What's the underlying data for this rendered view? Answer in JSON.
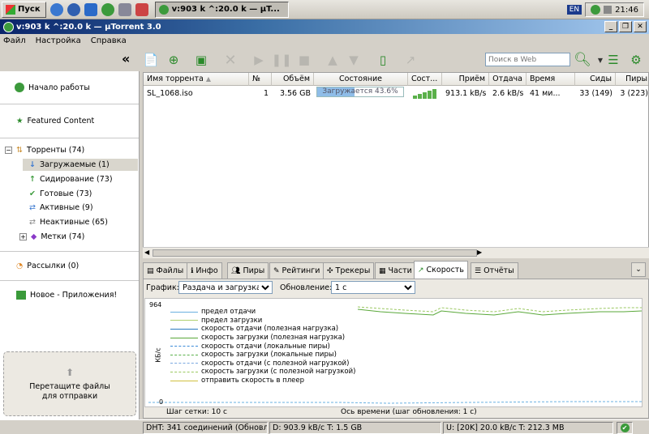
{
  "taskbar": {
    "start_label": "Пуск",
    "task_title": "v:903 k ^:20.0 k — µT...",
    "lang": "EN",
    "clock": "21:46"
  },
  "window": {
    "title": "v:903 k ^:20.0 k — µTorrent 3.0"
  },
  "menu": [
    "Файл",
    "Настройка",
    "Справка"
  ],
  "toolbar": {
    "collapse_label": "«",
    "search_placeholder": "Поиск в Web"
  },
  "sidebar": {
    "getting_started": "Начало работы",
    "featured": "Featured Content",
    "torrents": "Торренты (74)",
    "downloading": "Загружаемые (1)",
    "seeding": "Сидирование (73)",
    "completed": "Готовые (73)",
    "active": "Активные (9)",
    "inactive": "Неактивные (65)",
    "labels": "Метки (74)",
    "feeds": "Рассылки (0)",
    "apps": "Новое - Приложения!",
    "drop_line1": "Перетащите файлы",
    "drop_line2": "для отправки"
  },
  "table": {
    "headers": [
      "Имя торрента",
      "№",
      "Объём",
      "Состояние",
      "Сост...",
      "Приём",
      "Отдача",
      "Время",
      "Сиды",
      "Пиры"
    ],
    "row": {
      "name": "SL_1068.iso",
      "num": "1",
      "size": "3.56 GB",
      "status": "Загружается 43.6%",
      "progress": 0.436,
      "down": "913.1 kB/s",
      "up": "2.6 kB/s",
      "eta": "41 ми...",
      "seeds": "33 (149)",
      "peers": "3 (223)"
    }
  },
  "tabs": [
    "Файлы",
    "Инфо",
    "Пиры",
    "Рейтинги",
    "Трекеры",
    "Части",
    "Скорость",
    "Отчёты"
  ],
  "graph_panel": {
    "graph_label": "График:",
    "graph_value": "Раздача и загрузка",
    "update_label": "Обновление:",
    "update_value": "1 с",
    "y_max": "964",
    "y_min": "0",
    "y_unit": "КБ/с",
    "grid_step": "Шаг сетки: 10 с",
    "x_axis": "Ось времени (шаг обновления: 1 с)",
    "legend": [
      "предел отдачи",
      "предел загрузки",
      "скорость отдачи (полезная нагрузка)",
      "скорость загрузки (полезная нагрузка)",
      "скорость отдачи (локальные пиры)",
      "скорость загрузки (локальные пиры)",
      "скорость отдачи (с полезной нагрузкой)",
      "скорость загрузки (с полезной нагрузкой)",
      "отправить скорость в плеер"
    ],
    "legend_colors": [
      "#6ab0e0",
      "#b0d070",
      "#2a7ac0",
      "#5aa83a",
      "#3a8ad8",
      "#5ab04a",
      "#7aa8e0",
      "#9ac860",
      "#d0c040"
    ]
  },
  "status": {
    "dht": "DHT: 341 соединений  (Обновл.)",
    "down": "D: 903.9 kB/c T: 1.5 GB",
    "up": "U:  [20K] 20.0 kB/c T: 212.3 MB"
  }
}
